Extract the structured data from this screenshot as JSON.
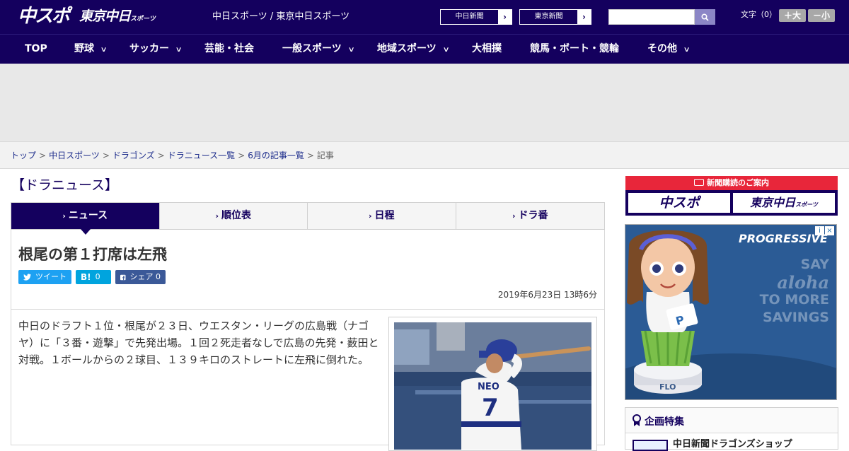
{
  "header": {
    "logo_chuspo": "中スポ",
    "logo_tokyo": "東京中日",
    "logo_tokyo_small": "スポーツ",
    "site_label": "中日スポーツ / 東京中日スポーツ",
    "paper_buttons": [
      {
        "label": "中日新聞",
        "arrow": "›"
      },
      {
        "label": "東京新聞",
        "arrow": "›"
      }
    ],
    "search_placeholder": "",
    "font_size_label": "文字（0）",
    "font_bigger": "＋大",
    "font_smaller": "－小"
  },
  "nav": {
    "items": [
      {
        "label": "TOP",
        "has_menu": false
      },
      {
        "label": "野球",
        "has_menu": true
      },
      {
        "label": "サッカー",
        "has_menu": true
      },
      {
        "label": "芸能・社会",
        "has_menu": false
      },
      {
        "label": "一般スポーツ",
        "has_menu": true
      },
      {
        "label": "地域スポーツ",
        "has_menu": true
      },
      {
        "label": "大相撲",
        "has_menu": false
      },
      {
        "label": "競馬・ボート・競輪",
        "has_menu": false
      },
      {
        "label": "その他",
        "has_menu": true
      }
    ],
    "chevron": "∨"
  },
  "breadcrumb": {
    "items": [
      "トップ",
      "中日スポーツ",
      "ドラゴンズ",
      "ドラニュース一覧",
      "6月の記事一覧"
    ],
    "current": "記事",
    "separator": ">"
  },
  "section_title": "【ドラニュース】",
  "tabs": [
    {
      "label": "ニュース",
      "active": true
    },
    {
      "label": "順位表",
      "active": false
    },
    {
      "label": "日程",
      "active": false
    },
    {
      "label": "ドラ番",
      "active": false
    }
  ],
  "tab_arrow": "›",
  "article": {
    "headline": "根尾の第１打席は左飛",
    "share": {
      "tweet_label": "ツイート",
      "hatena_icon": "B!",
      "hatena_count": "0",
      "facebook_label": "シェア",
      "facebook_count": "0"
    },
    "date": "2019年6月23日 13時6分",
    "body": "中日のドラフト１位・根尾が２３日、ウエスタン・リーグの広島戦（ナゴヤ）に「３番・遊撃」で先発出場。１回２死走者なしで広島の先発・薮田と対戦。１ボールからの２球目、１３９キロのストレートに左飛に倒れた。",
    "photo_jersey_name": "NEO",
    "photo_jersey_number": "7"
  },
  "sidebar": {
    "subscribe_head": "新聞購読のご案内",
    "subscribe_left": "中スポ",
    "subscribe_right": "東京中日",
    "subscribe_right_small": "スポーツ",
    "ad_brand": "PROGRESSIVE",
    "ad_tag_say": "SAY",
    "ad_tag_aloha": "aloha",
    "ad_tag_to_more": "TO MORE",
    "ad_tag_savings": "SAVINGS",
    "ad_figure_label": "FLO",
    "ad_close_icons": [
      "i",
      "×"
    ],
    "feature_title": "企画特集",
    "feature_item": "中日新聞ドラゴンズショップ"
  },
  "colors": {
    "brand_navy": "#14005e",
    "accent_red": "#e8263a",
    "twitter": "#1da1f2",
    "hatena": "#00a4de",
    "facebook": "#3b5998",
    "ad_blue": "#2b5b95"
  }
}
